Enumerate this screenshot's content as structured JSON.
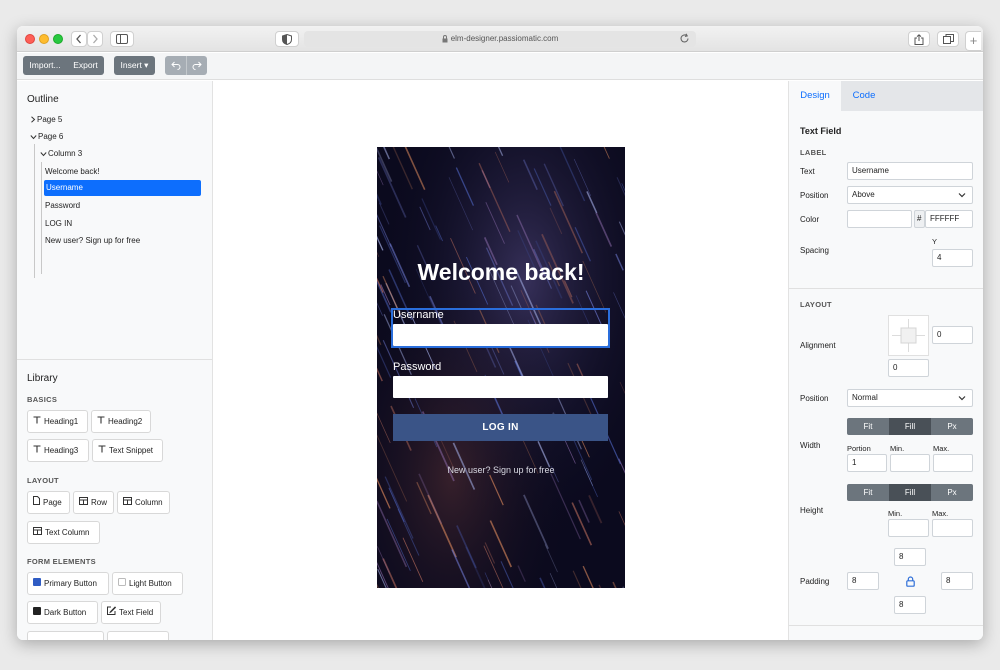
{
  "browser": {
    "url": "elm-designer.passiomatic.com"
  },
  "toolbar": {
    "import_label": "Import...",
    "export_label": "Export",
    "insert_label": "Insert ▾"
  },
  "outline": {
    "title": "Outline",
    "items": [
      "Page 5",
      "Page 6",
      "Column 3",
      "Welcome back!",
      "Username",
      "Password",
      "LOG IN",
      "New user? Sign up for free"
    ]
  },
  "library": {
    "title": "Library",
    "categories": {
      "basics": "BASICS",
      "layout": "LAYOUT",
      "form": "FORM ELEMENTS"
    },
    "basics": [
      "Heading1",
      "Heading2",
      "Heading3",
      "Text Snippet"
    ],
    "layout": [
      "Page",
      "Row",
      "Column",
      "Text Column"
    ],
    "form": [
      "Primary Button",
      "Light Button",
      "Dark Button",
      "Text Field"
    ]
  },
  "preview": {
    "heading": "Welcome back!",
    "username_label": "Username",
    "password_label": "Password",
    "login_label": "LOG IN",
    "signup_text": "New user? Sign up for free"
  },
  "inspector": {
    "tabs": [
      "Design",
      "Code"
    ],
    "element_title": "Text Field",
    "label_section": "LABEL",
    "text_label": "Text",
    "text_value": "Username",
    "position_label": "Position",
    "position_value": "Above",
    "color_label": "Color",
    "color_hash": "#",
    "color_value": "FFFFFF",
    "spacing_label": "Spacing",
    "spacing_y_label": "Y",
    "spacing_y_value": "4",
    "layout_section": "LAYOUT",
    "alignment_label": "Alignment",
    "align_x_value": "0",
    "align_y_value": "0",
    "layout_position_label": "Position",
    "layout_position_value": "Normal",
    "width_label": "Width",
    "width_modes": [
      "Fit",
      "Fill",
      "Px"
    ],
    "width_portion_label": "Portion",
    "width_portion_value": "1",
    "width_min_label": "Min.",
    "width_max_label": "Max.",
    "height_label": "Height",
    "height_modes": [
      "Fit",
      "Fill",
      "Px"
    ],
    "height_min_label": "Min.",
    "height_max_label": "Max.",
    "padding_label": "Padding",
    "padding_top": "8",
    "padding_left": "8",
    "padding_right": "8",
    "padding_bottom": "8"
  },
  "colors": {
    "accent": "#0d6efd",
    "login_button": "#3a5487",
    "toolbar_button": "#6c757d"
  }
}
